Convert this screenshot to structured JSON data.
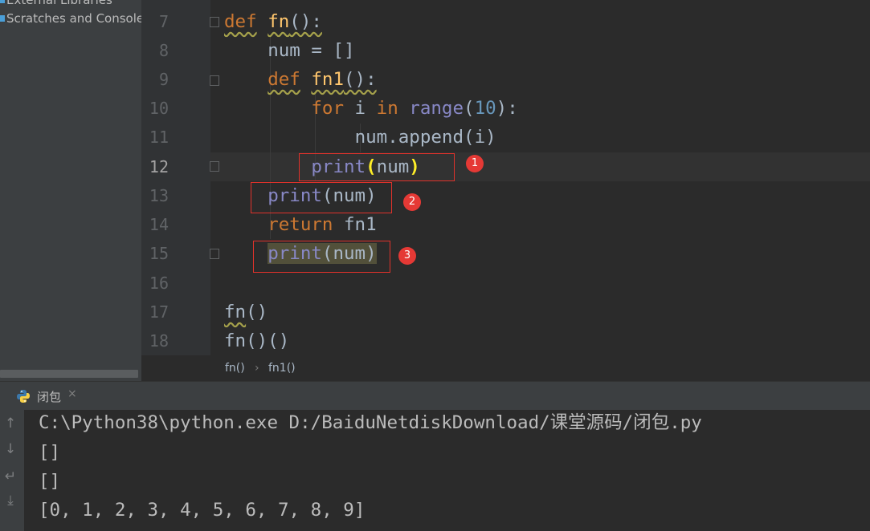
{
  "project_panel": {
    "items": [
      {
        "label": "External Libraries"
      },
      {
        "label": "Scratches and Consoles"
      }
    ]
  },
  "editor": {
    "line_numbers": [
      "7",
      "8",
      "9",
      "10",
      "11",
      "12",
      "13",
      "14",
      "15",
      "16",
      "17",
      "18"
    ],
    "current_line": "12",
    "lines": [
      {
        "n": "7",
        "tokens": [
          [
            "kw",
            "def"
          ],
          [
            "",
            " "
          ],
          [
            "fnname",
            "fn"
          ],
          [
            "",
            "():"
          ]
        ]
      },
      {
        "n": "8",
        "text": "    num = []"
      },
      {
        "n": "9",
        "text": "    def fn1():"
      },
      {
        "n": "10",
        "text": "        for i in range(10):"
      },
      {
        "n": "11",
        "text": "            num.append(i)"
      },
      {
        "n": "12",
        "text": "        print(num)"
      },
      {
        "n": "13",
        "text": "    print(num)"
      },
      {
        "n": "14",
        "text": "    return fn1"
      },
      {
        "n": "15",
        "text": "    print(num)"
      },
      {
        "n": "16",
        "text": ""
      },
      {
        "n": "17",
        "text": "fn()"
      },
      {
        "n": "18",
        "text": "fn()()"
      }
    ],
    "code": {
      "l7_kw": "def",
      "l7_name": "fn",
      "l7_rest": "():",
      "l8": "num = []",
      "l9_kw": "def",
      "l9_name": "fn1",
      "l9_rest": "():",
      "l10_kw1": "for",
      "l10_var": " i ",
      "l10_kw2": "in",
      "l10_builtin": "range",
      "l10_open": "(",
      "l10_num": "10",
      "l10_close": "):",
      "l11": "num.append(i)",
      "l12_builtin": "print",
      "l12_open": "(",
      "l12_arg": "num",
      "l12_close": ")",
      "l13_builtin": "print",
      "l13_rest": "(num)",
      "l14_kw": "return",
      "l14_rest": " fn1",
      "l15_builtin": "print",
      "l15_rest": "(num)",
      "l17_name": "fn",
      "l17_rest": "()",
      "l18": "fn()()"
    },
    "annotations": [
      "1",
      "2",
      "3"
    ]
  },
  "breadcrumb": {
    "items": [
      "fn()",
      "fn1()"
    ],
    "separator": "›"
  },
  "run_panel": {
    "tab_label": "闭包",
    "tab_icon": "python-icon",
    "close_glyph": "×",
    "toolbar": [
      {
        "icon": "arrow-up-icon",
        "glyph": "↑"
      },
      {
        "icon": "arrow-down-icon",
        "glyph": "↓"
      },
      {
        "icon": "soft-wrap-icon",
        "glyph": "↵"
      },
      {
        "icon": "scroll-to-end-icon",
        "glyph": "⤓"
      }
    ],
    "console_lines": [
      "C:\\Python38\\python.exe D:/BaiduNetdiskDownload/课堂源码/闭包.py",
      "[]",
      "[]",
      "[0, 1, 2, 3, 4, 5, 6, 7, 8, 9]"
    ]
  },
  "colors": {
    "keyword": "#cc7832",
    "function_name": "#ffc66d",
    "builtin": "#8888c6",
    "number": "#6897bb",
    "annotation_red": "#e53935"
  }
}
